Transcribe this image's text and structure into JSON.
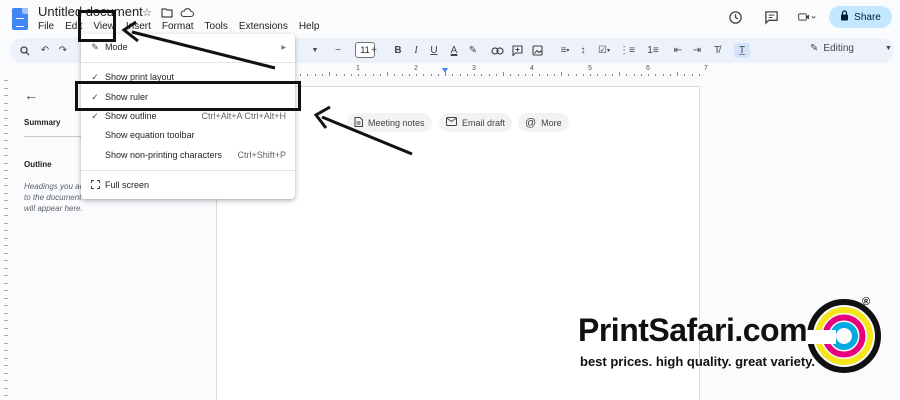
{
  "app": {
    "doc_title": "Untitled document",
    "menus": [
      "File",
      "Edit",
      "View",
      "Insert",
      "Format",
      "Tools",
      "Extensions",
      "Help"
    ],
    "share_label": "Share",
    "share_icon": "lock-icon",
    "font_size": "11",
    "mode_label": "Editing"
  },
  "ruler": {
    "labels": [
      "1",
      "2",
      "3",
      "4",
      "5",
      "6",
      "7"
    ]
  },
  "sidebar": {
    "summary_label": "Summary",
    "outline_label": "Outline",
    "outline_hint": "Headings you add to the document will appear here."
  },
  "document": {
    "chips": [
      {
        "label": "Meeting notes",
        "icon": "document-icon"
      },
      {
        "label": "Email draft",
        "icon": "email-icon"
      },
      {
        "label": "More",
        "icon": "at-icon"
      }
    ]
  },
  "view_menu": {
    "items": [
      {
        "label": "Mode",
        "checked": false,
        "icon": "pencil-icon",
        "submenu": true
      },
      {
        "label": "Show print layout",
        "checked": true
      },
      {
        "label": "Show ruler",
        "checked": true
      },
      {
        "label": "Show outline",
        "checked": true,
        "shortcut": "Ctrl+Alt+A Ctrl+Alt+H"
      },
      {
        "label": "Show equation toolbar",
        "checked": false
      },
      {
        "label": "Show non-printing characters",
        "checked": false,
        "shortcut": "Ctrl+Shift+P"
      },
      {
        "label": "Full screen",
        "checked": false,
        "icon": "fullscreen-icon"
      }
    ]
  },
  "watermark": {
    "brand": "PrintSafari.com",
    "tagline": "best prices. high quality. great variety.",
    "registered": "®"
  },
  "colors": {
    "accent": "#4285f4",
    "share_bg": "#c2e7ff",
    "toolbar_bg": "#edf2fa",
    "highlight": "#111111",
    "logo_yellow": "#f5e61b",
    "logo_magenta": "#e6007e",
    "logo_cyan": "#00a9e0"
  }
}
